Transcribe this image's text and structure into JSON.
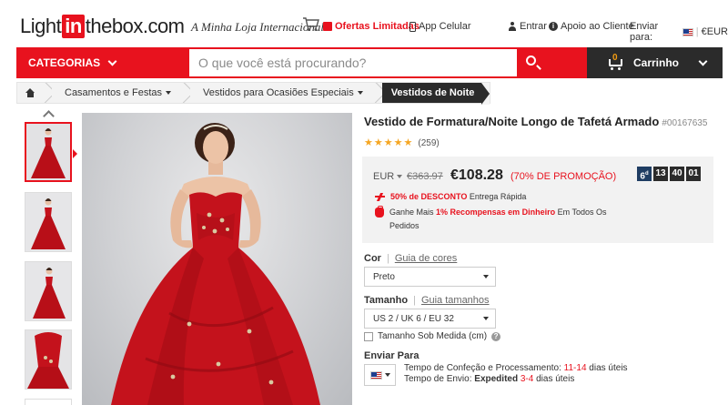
{
  "header": {
    "logo_pre": "Light",
    "logo_in": "in",
    "logo_post": "thebox.com",
    "tagline": "A Minha Loja Internacional",
    "promo_link": "Ofertas Limitadas",
    "app_link": "App Celular",
    "login": "Entrar",
    "support": "Apoio ao Cliente",
    "ship_to": "Enviar para:",
    "currency_short": "€EUR"
  },
  "nav": {
    "categories": "CATEGORIAS",
    "search_placeholder": "O que você está procurando?",
    "cart_count": "0",
    "cart_label": "Carrinho"
  },
  "breadcrumb": {
    "items": [
      "Casamentos e Festas",
      "Vestidos para Ocasiões Especiais"
    ],
    "active": "Vestidos de Noite"
  },
  "product": {
    "title": "Vestido de Formatura/Noite Longo de Tafetá Armado",
    "sku": "#00167635",
    "review_count": "(259)",
    "currency": "EUR",
    "old_price": "€363.97",
    "new_price": "€108.28",
    "discount": "(70% DE PROMOÇÃO)",
    "countdown": [
      "6",
      "13",
      "40",
      "01"
    ],
    "countdown_day_suffix": "d",
    "promo1_red": "50% de DESCONTO",
    "promo1_rest": "Entrega Rápida",
    "promo2_a": "Ganhe Mais",
    "promo2_red": "1% Recompensas em Dinheiro",
    "promo2_b": "Em Todos Os",
    "promo2_c": "Pedidos"
  },
  "options": {
    "color_label": "Cor",
    "color_guide": "Guia de cores",
    "color_value": "Preto",
    "size_label": "Tamanho",
    "size_guide": "Guia tamanhos",
    "size_value": "US 2 / UK 6 / EU 32",
    "custom_size": "Tamanho Sob Medida (cm)"
  },
  "shipping": {
    "label": "Enviar Para",
    "line1_pre": "Tempo de Confeção e Processamento:",
    "line1_red": "11-14",
    "line1_post": "dias úteis",
    "line2_pre": "Tempo de Envio:",
    "line2_bold": "Expedited",
    "line2_red": "3-4",
    "line2_post": "dias úteis"
  },
  "colors": {
    "brand_red": "#e8121e",
    "dark": "#2b2b2b",
    "dress_red": "#c4121c",
    "star": "#f5a623"
  }
}
